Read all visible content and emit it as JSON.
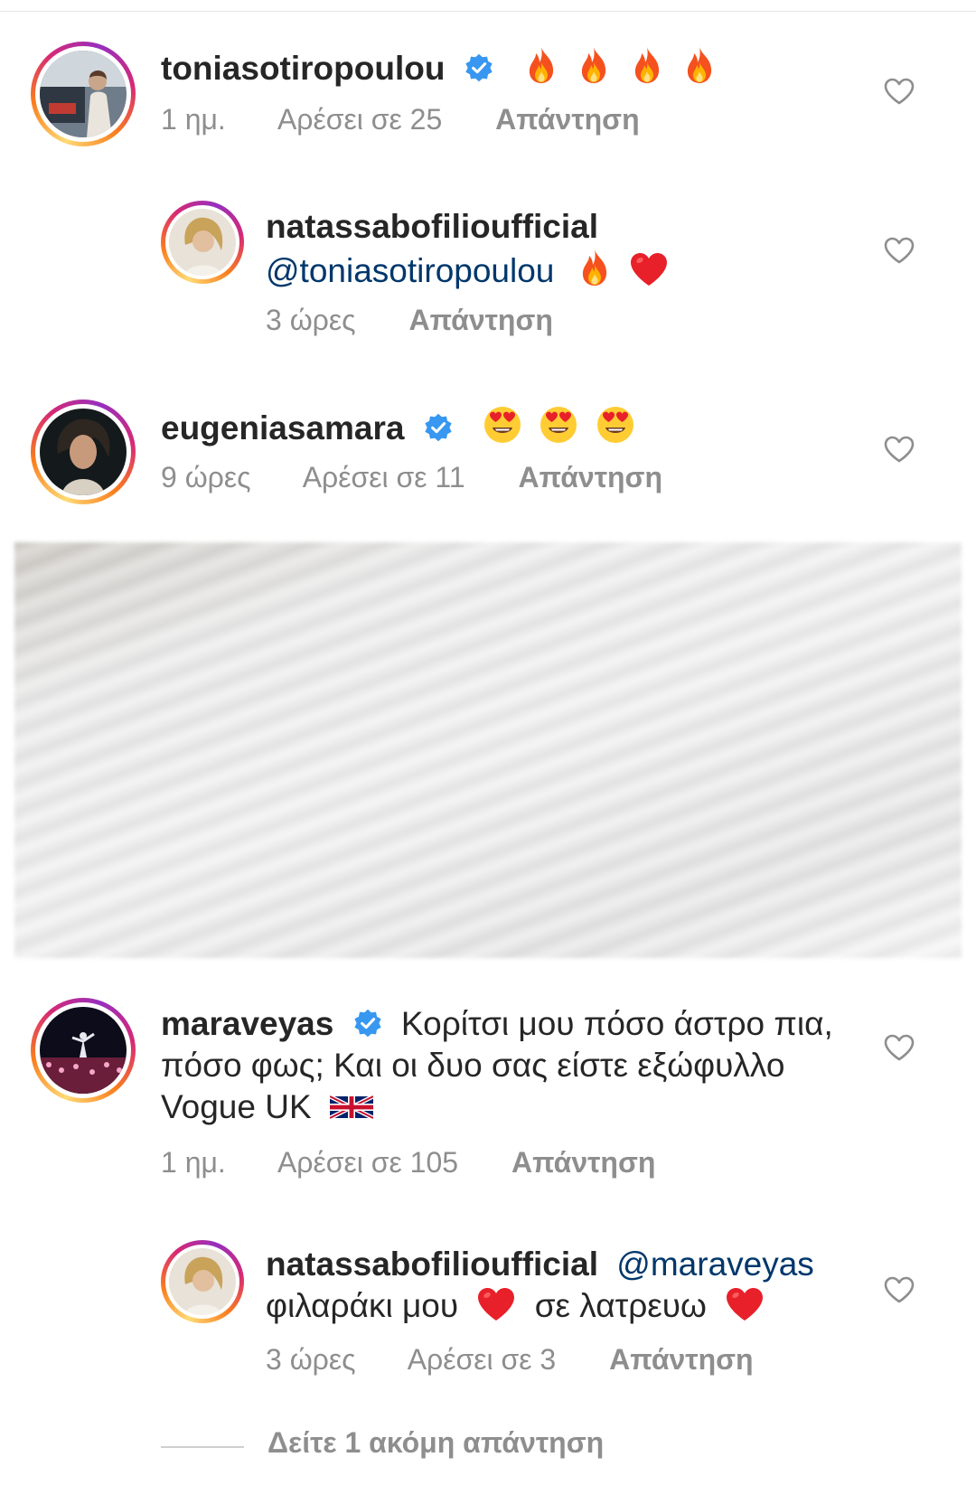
{
  "colors": {
    "text": "#262626",
    "muted": "#8e8e8e",
    "mention": "#00376b",
    "verified": "#3897f0",
    "heart_red": "#e0245e"
  },
  "comments": [
    {
      "username": "toniasotiropoulou",
      "verified": true,
      "emoji": [
        "fire",
        "fire",
        "fire",
        "fire"
      ],
      "time": "1 ημ.",
      "likes": "Αρέσει σε 25",
      "reply": "Απάντηση"
    },
    {
      "username": "natassabofilioufficial",
      "mention": "@toniasotiropoulou",
      "emoji": [
        "fire",
        "red-heart"
      ],
      "time": "3 ώρες",
      "reply": "Απάντηση"
    },
    {
      "username": "eugeniasamara",
      "verified": true,
      "emoji": [
        "heart-eyes",
        "heart-eyes",
        "heart-eyes"
      ],
      "time": "9 ώρες",
      "likes": "Αρέσει σε 11",
      "reply": "Απάντηση"
    },
    {
      "username": "maraveyas",
      "verified": true,
      "text_line1": "Κορίτσι μου πόσο άστρο πια,",
      "text_line2": "πόσο φως; Και οι δυο σας είστε εξώφυλλο",
      "text_line3": "Vogue UK",
      "emoji": [
        "uk-flag"
      ],
      "time": "1 ημ.",
      "likes": "Αρέσει σε 105",
      "reply": "Απάντηση"
    },
    {
      "username": "natassabofilioufficial",
      "mention": "@maraveyas",
      "text_part1": "φιλαράκι μου",
      "text_part2": "σε λατρευω",
      "emoji": [
        "red-heart",
        "red-heart"
      ],
      "time": "3 ώρες",
      "likes": "Αρέσει σε 3",
      "reply": "Απάντηση"
    }
  ],
  "view_more": "Δείτε 1 ακόμη απάντηση"
}
